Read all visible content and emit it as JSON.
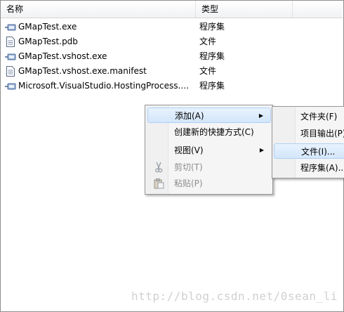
{
  "columns": {
    "name": "名称",
    "type": "类型"
  },
  "files": [
    {
      "icon": "assembly-icon",
      "name": "GMapTest.exe",
      "type": "程序集"
    },
    {
      "icon": "document-icon",
      "name": "GMapTest.pdb",
      "type": "文件"
    },
    {
      "icon": "assembly-icon",
      "name": "GMapTest.vshost.exe",
      "type": "程序集"
    },
    {
      "icon": "document-icon",
      "name": "GMapTest.vshost.exe.manifest",
      "type": "文件"
    },
    {
      "icon": "assembly-icon",
      "name": "Microsoft.VisualStudio.HostingProcess.Uti...",
      "type": "程序集"
    }
  ],
  "context_menu": {
    "add": "添加(A)",
    "create_shortcut": "创建新的快捷方式(C)",
    "view": "视图(V)",
    "cut": "剪切(T)",
    "paste": "粘贴(P)"
  },
  "submenu": {
    "folder": "文件夹(F)",
    "project_output": "项目输出(P)",
    "file": "文件(I)...",
    "assembly": "程序集(A)..."
  },
  "watermark": "http://blog.csdn.net/0sean_li"
}
